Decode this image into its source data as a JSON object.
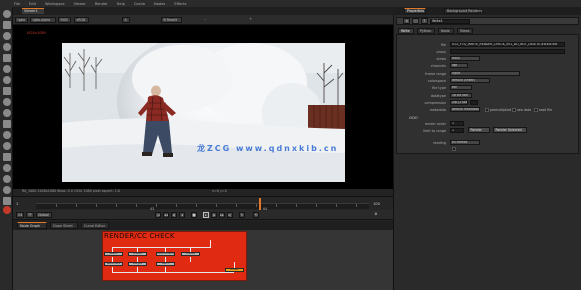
{
  "menubar": {
    "items": [
      "File",
      "Edit",
      "Workspace",
      "Viewer",
      "Render",
      "Help",
      "Cache",
      "Nodes",
      "Effects",
      "Render"
    ]
  },
  "viewer": {
    "tab_label": "Viewer1",
    "toolbar": {
      "channels": "rgba",
      "alpha": "rgba.alpha",
      "gain": "RGB",
      "colorspace": "sRGB",
      "input_a": "A",
      "input_b": "B Read5"
    },
    "pixel_info": "1920x1080",
    "frame_info": "Rd_1080  2048x1080  Bbox: 0 0  1920 1080  pixel aspect: 1:0",
    "frame_info_right": "x=0 y=0",
    "watermark": "龙ZCG  www.qdnxkib.cn"
  },
  "timeline": {
    "start": "1",
    "end": "100",
    "mid_label": "43",
    "playhead_label": "64",
    "fps": "24",
    "tf_label": "TF",
    "global": "Global"
  },
  "nodegraph": {
    "tabs": [
      "Node Graph",
      "Dope Sheet",
      "Curve Editor"
    ],
    "backdrop_label": "RENDER/CC CHECK",
    "nodes": [
      {
        "label": "Read1"
      },
      {
        "label": "Grade1"
      },
      {
        "label": "ColorCorrect1"
      },
      {
        "label": "Grade2"
      },
      {
        "label": "Reformat1"
      },
      {
        "label": "Merge1"
      },
      {
        "label": "Blur1"
      },
      {
        "label": "Write1"
      }
    ]
  },
  "properties": {
    "tabs": [
      "Properties",
      "Background Renders"
    ],
    "node_name": "Write1",
    "subtabs": [
      "Write",
      "Python",
      "Node",
      "Views"
    ],
    "rows": [
      {
        "label": "file",
        "value": "X:/Z_FTS/_WRITE_RENDER_CHECK_V01_DO_NOT_DELETE.####.exr"
      },
      {
        "label": "proxy",
        "value": ""
      },
      {
        "label": "views",
        "value": "main"
      },
      {
        "label": "channels",
        "value": "rgb"
      },
      {
        "label": "frame range",
        "value": "input"
      },
      {
        "label": "colorspace",
        "value": "default (linear)"
      },
      {
        "label": "file type",
        "value": "exr"
      },
      {
        "label": "datatype",
        "value": "16 bit half"
      },
      {
        "label": "compression",
        "value": "Zip (1 scanline)"
      },
      {
        "label": "metadata",
        "value": "default metadata"
      }
    ],
    "checkbox_labels": [
      "premultiplied",
      "raw data",
      "read file"
    ],
    "section_label": "OCIO",
    "extra_rows": [
      {
        "label": "render order",
        "value": "1"
      },
      {
        "label": "limit to range",
        "value": "1"
      },
      {
        "label": "reading",
        "value": "all frames"
      }
    ],
    "buttons": [
      "Render",
      "Render Selected"
    ],
    "colors": {
      "accent": "#e0782a",
      "backdrop": "#e02a12",
      "write_node": "#e8a21a"
    }
  }
}
